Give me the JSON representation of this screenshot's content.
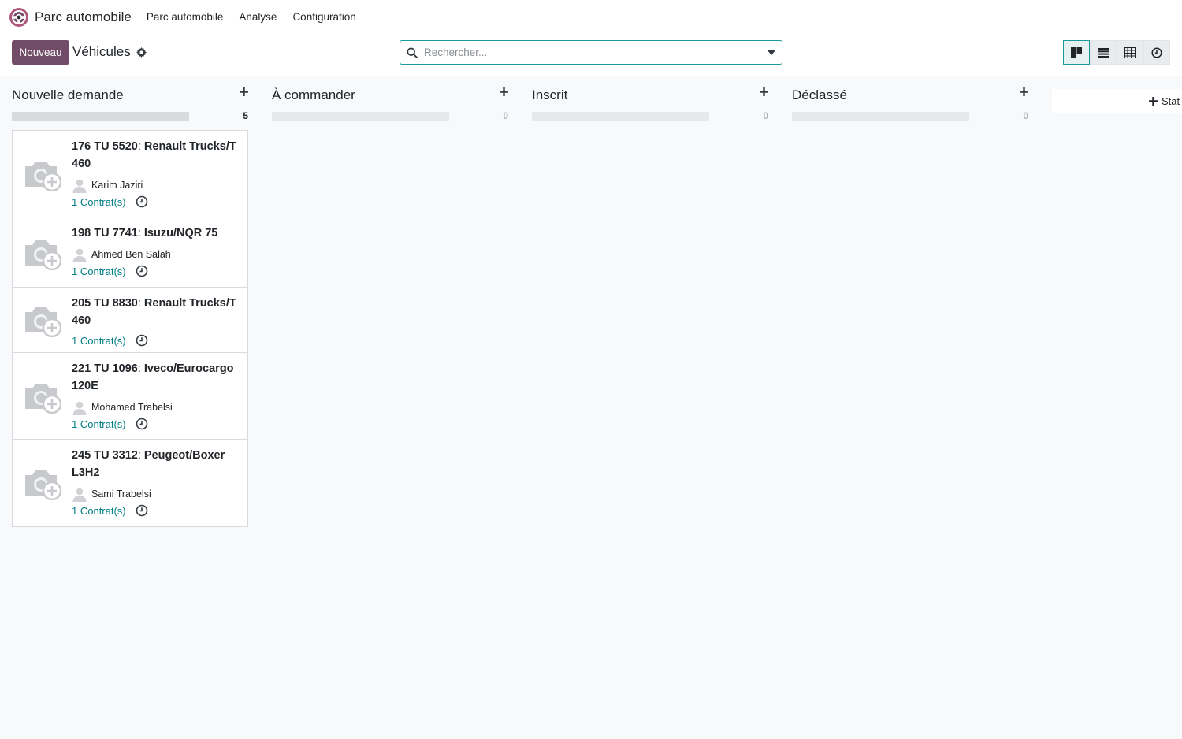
{
  "topnav": {
    "app_name": "Parc automobile",
    "menu": [
      "Parc automobile",
      "Analyse",
      "Configuration"
    ]
  },
  "control": {
    "new_label": "Nouveau",
    "breadcrumb": "Véhicules",
    "search_placeholder": "Rechercher..."
  },
  "colors": {
    "brand": "#714b67",
    "accent": "#017e84"
  },
  "columns": [
    {
      "title": "Nouvelle demande",
      "count": "5"
    },
    {
      "title": "À commander",
      "count": "0"
    },
    {
      "title": "Inscrit",
      "count": "0"
    },
    {
      "title": "Déclassé",
      "count": "0"
    }
  ],
  "add_stage_label": "Stat",
  "cards": [
    {
      "plate": "176 TU 5520",
      "sep": ": ",
      "model": "Renault Trucks/T 460",
      "driver": "Karim Jaziri",
      "contracts": "1 Contrat(s)"
    },
    {
      "plate": "198 TU 7741",
      "sep": ": ",
      "model": "Isuzu/NQR 75",
      "driver": "Ahmed Ben Salah",
      "contracts": "1 Contrat(s)"
    },
    {
      "plate": "205 TU 8830",
      "sep": ": ",
      "model": "Renault Trucks/T 460",
      "driver": "",
      "contracts": "1 Contrat(s)"
    },
    {
      "plate": "221 TU 1096",
      "sep": ": ",
      "model": "Iveco/Eurocargo 120E",
      "driver": "Mohamed Trabelsi",
      "contracts": "1 Contrat(s)"
    },
    {
      "plate": "245 TU 3312",
      "sep": ": ",
      "model": "Peugeot/Boxer L3H2",
      "driver": "Sami Trabelsi",
      "contracts": "1 Contrat(s)"
    }
  ]
}
